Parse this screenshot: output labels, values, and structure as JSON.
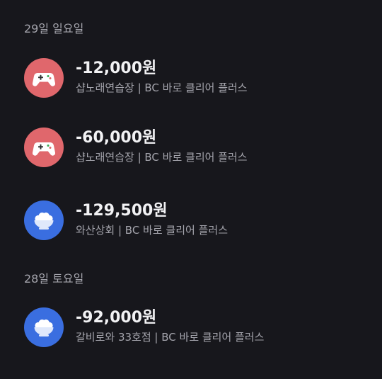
{
  "groups": [
    {
      "date": "29일 일요일",
      "transactions": [
        {
          "amount": "-12,000원",
          "description": "샵노래연습장 | BC 바로 클리어 플러스",
          "icon": "game-controller-icon",
          "icon_color": "#e0676c"
        },
        {
          "amount": "-60,000원",
          "description": "샵노래연습장 | BC 바로 클리어 플러스",
          "icon": "game-controller-icon",
          "icon_color": "#e0676c"
        },
        {
          "amount": "-129,500원",
          "description": "와산상회 | BC 바로 클리어 플러스",
          "icon": "rice-bowl-icon",
          "icon_color": "#3a6ee0"
        }
      ]
    },
    {
      "date": "28일 토요일",
      "transactions": [
        {
          "amount": "-92,000원",
          "description": "갈비로와 33호점 | BC 바로 클리어 플러스",
          "icon": "rice-bowl-icon",
          "icon_color": "#3a6ee0"
        }
      ]
    }
  ],
  "colors": {
    "background": "#17171c",
    "primary_text": "#f2f2f4",
    "secondary_text": "#a5a5ad",
    "game_icon_bg": "#e0676c",
    "food_icon_bg": "#3a6ee0"
  }
}
